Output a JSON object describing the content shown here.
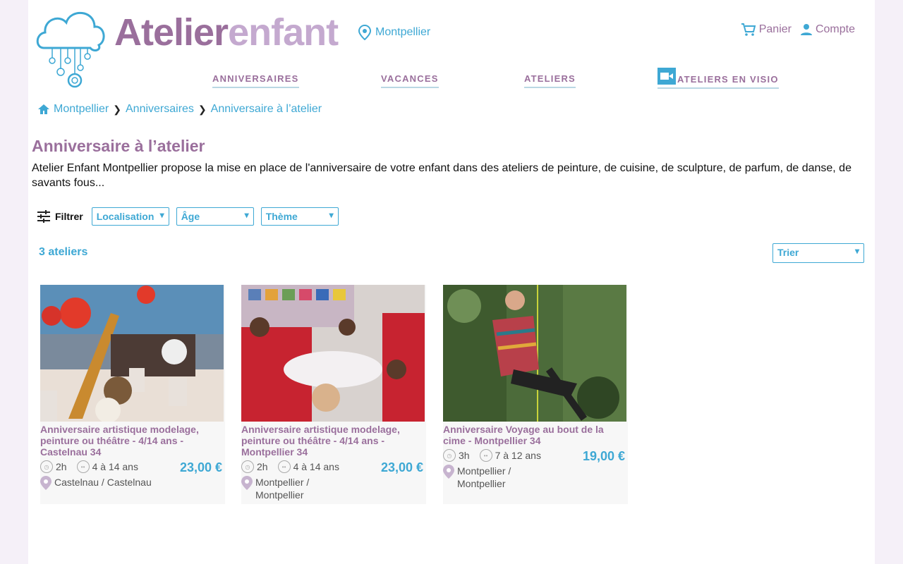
{
  "header": {
    "logo_primary": "Atelier",
    "logo_secondary": "enfant",
    "location": "Montpellier",
    "cart_label": "Panier",
    "account_label": "Compte"
  },
  "nav": {
    "items": [
      {
        "label": "ANNIVERSAIRES"
      },
      {
        "label": "VACANCES"
      },
      {
        "label": "ATELIERS"
      },
      {
        "label": "ATELIERS EN VISIO"
      }
    ]
  },
  "breadcrumb": [
    {
      "label": "Montpellier"
    },
    {
      "label": "Anniversaires"
    },
    {
      "label": "Anniversaire à l’atelier"
    }
  ],
  "page": {
    "title": "Anniversaire à l’atelier",
    "intro": "Atelier Enfant Montpellier propose la mise en place de l'anniversaire de votre enfant dans des ateliers de peinture, de cuisine, de sculpture, de parfum, de danse, de savants fous..."
  },
  "filters": {
    "label": "Filtrer",
    "selects": [
      {
        "value": "Localisation"
      },
      {
        "value": "Âge"
      },
      {
        "value": "Thème"
      }
    ]
  },
  "results": {
    "count": "3 ateliers",
    "sort": "Trier"
  },
  "cards": [
    {
      "title": "Anniversaire artistique modelage, peinture ou théâtre - 4/14 ans - Castelnau 34",
      "duration": "2h",
      "age": "4 à 14 ans",
      "price": "23,00 €",
      "place": "Castelnau / Castelnau"
    },
    {
      "title": "Anniversaire artistique modelage, peinture ou théâtre - 4/14 ans - Montpellier 34",
      "duration": "2h",
      "age": "4 à 14 ans",
      "price": "23,00 €",
      "place": "Montpellier / Montpellier"
    },
    {
      "title": "Anniversaire Voyage au bout de la cime - Montpellier 34",
      "duration": "3h",
      "age": "7 à 12 ans",
      "price": "19,00 €",
      "place": "Montpellier / Montpellier"
    }
  ],
  "colors": {
    "brand_purple": "#9a6f9c",
    "brand_light_purple": "#c4a9cf",
    "accent_blue": "#3ea8d4"
  }
}
